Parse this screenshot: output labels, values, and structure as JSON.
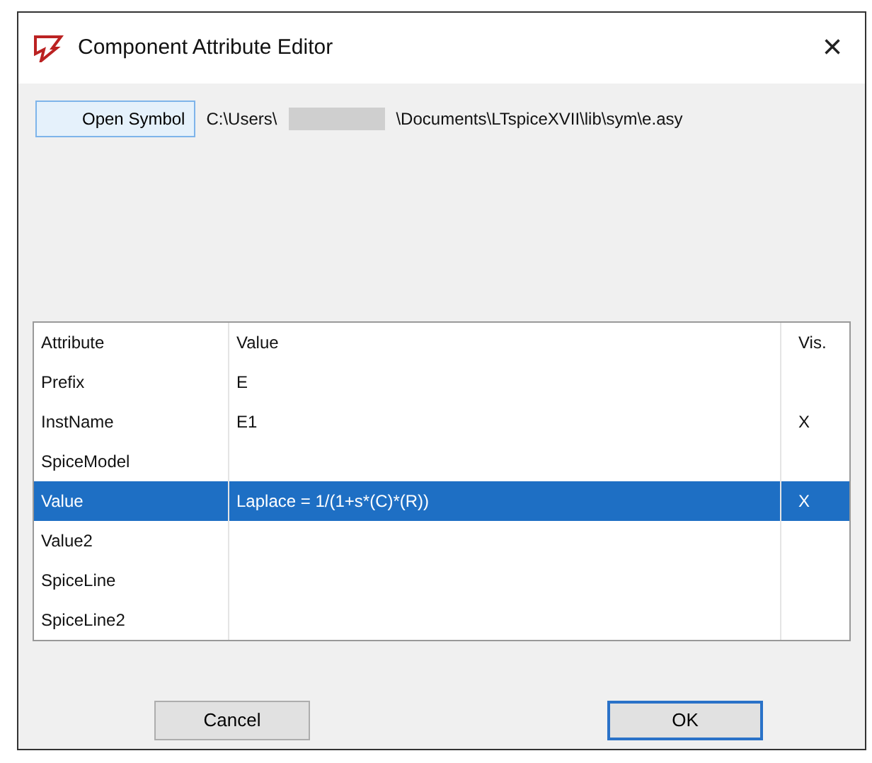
{
  "window": {
    "title": "Component Attribute Editor",
    "close": "×"
  },
  "open_symbol": {
    "label": "Open Symbol",
    "path_start": "C:\\Users\\",
    "path_redacted": true,
    "path_end": "\\Documents\\LTspiceXVII\\lib\\sym\\e.asy"
  },
  "table": {
    "columns": [
      "Attribute",
      "Value",
      "Vis."
    ],
    "rows": [
      {
        "attribute": "Prefix",
        "value": "E",
        "vis": "",
        "selected": false
      },
      {
        "attribute": "InstName",
        "value": "E1",
        "vis": "X",
        "selected": false
      },
      {
        "attribute": "SpiceModel",
        "value": "",
        "vis": "",
        "selected": false
      },
      {
        "attribute": "Value",
        "value": "Laplace = 1/(1+s*(C)*(R))",
        "vis": "X",
        "selected": true
      },
      {
        "attribute": "Value2",
        "value": "",
        "vis": "",
        "selected": false
      },
      {
        "attribute": "SpiceLine",
        "value": "",
        "vis": "",
        "selected": false
      },
      {
        "attribute": "SpiceLine2",
        "value": "",
        "vis": "",
        "selected": false
      }
    ]
  },
  "buttons": [
    {
      "label": "Cancel",
      "default": false
    },
    {
      "label": "OK",
      "default": true
    }
  ]
}
